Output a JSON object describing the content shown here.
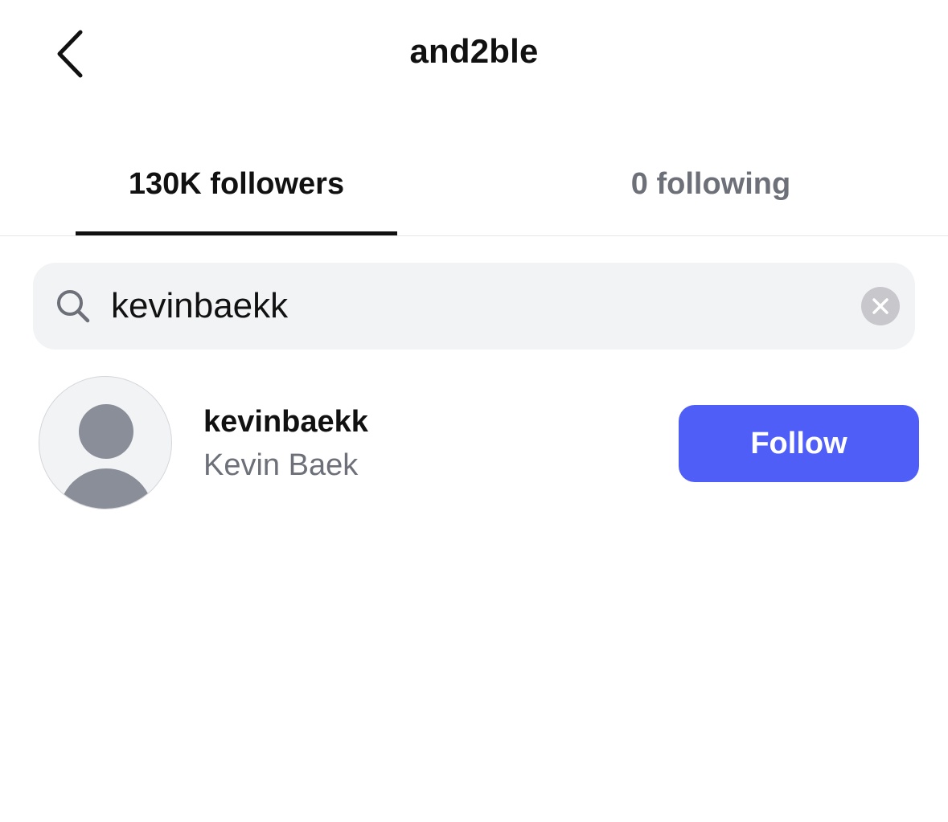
{
  "header": {
    "title": "and2ble",
    "back_icon": "chevron-left-icon"
  },
  "tabs": [
    {
      "label": "130K followers",
      "active": true
    },
    {
      "label": "0 following",
      "active": false
    }
  ],
  "search": {
    "value": "kevinbaekk",
    "search_icon": "search-icon",
    "clear_icon": "clear-icon"
  },
  "results": [
    {
      "username": "kevinbaekk",
      "full_name": "Kevin Baek",
      "avatar_icon": "default-avatar-icon",
      "follow_label": "Follow"
    }
  ],
  "colors": {
    "accent": "#4f5ef7",
    "text_primary": "#111111",
    "text_secondary": "#6d7079",
    "search_bg": "#f2f3f5",
    "avatar_gray": "#8a8e98"
  }
}
